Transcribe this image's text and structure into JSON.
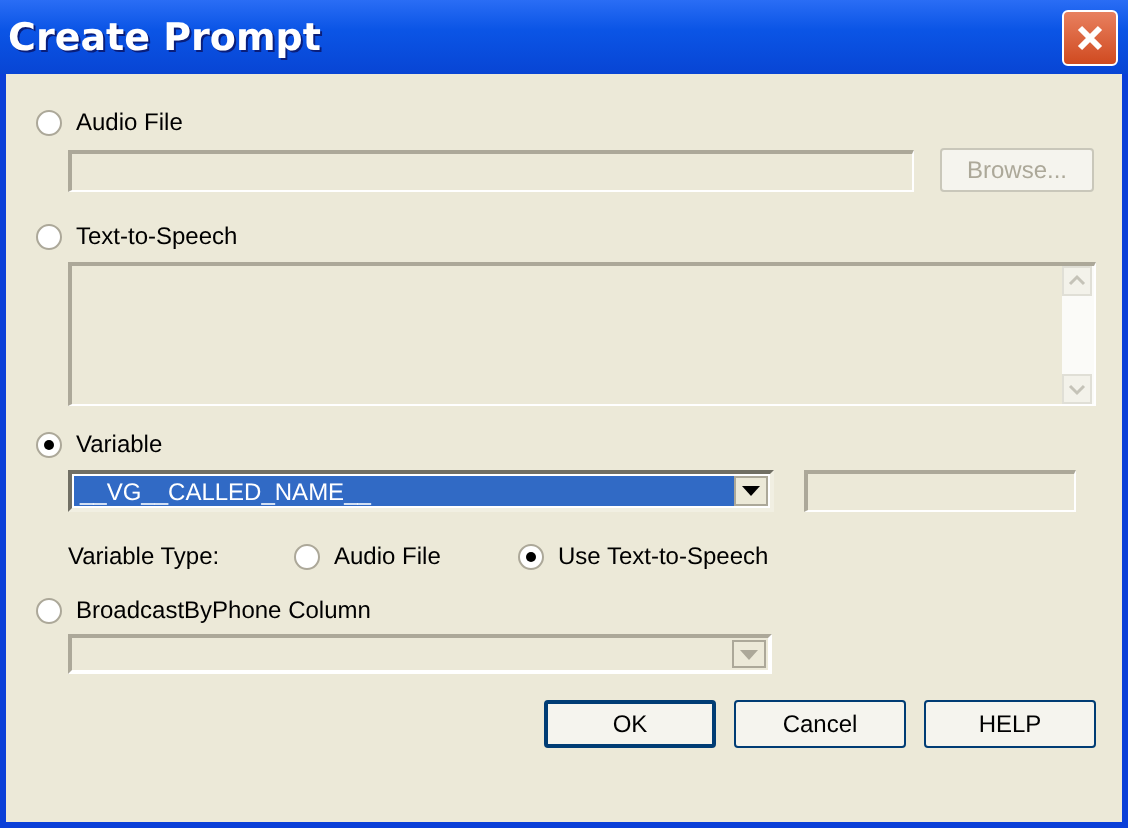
{
  "window": {
    "title": "Create Prompt"
  },
  "audio_file": {
    "label": "Audio File",
    "selected": false,
    "path_field": {
      "disabled": true
    },
    "browse_button": {
      "label": "Browse...",
      "disabled": true
    }
  },
  "text_to_speech": {
    "label": "Text-to-Speech",
    "selected": false,
    "text_area": {
      "disabled": true
    }
  },
  "variable": {
    "label": "Variable",
    "selected": true,
    "dropdown": {
      "value": "__VG__CALLED_NAME__",
      "disabled": false
    },
    "side_field": {
      "disabled": true
    },
    "type_label": "Variable Type:",
    "type_options": [
      {
        "label": "Audio File",
        "selected": false
      },
      {
        "label": "Use Text-to-Speech",
        "selected": true
      }
    ]
  },
  "broadcast_column": {
    "label": "BroadcastByPhone Column",
    "selected": false,
    "dropdown": {
      "disabled": true
    }
  },
  "buttons": [
    {
      "label": "OK",
      "default": true
    },
    {
      "label": "Cancel",
      "default": false
    },
    {
      "label": "HELP",
      "default": false
    }
  ]
}
